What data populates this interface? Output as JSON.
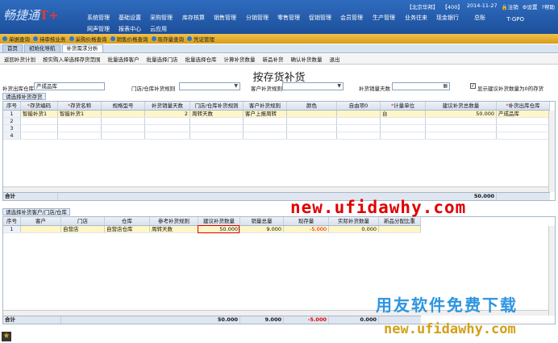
{
  "app": {
    "logo_text": "畅捷通",
    "logo_mark": "T+"
  },
  "menu_row1": [
    "系统管理",
    "基础设置",
    "采购管理",
    "库存核算",
    "销售管理",
    "分销管理",
    "零售管理",
    "促销管理",
    "会员管理",
    "生产管理",
    "业务往来",
    "现金银行",
    "总账"
  ],
  "menu_row2": [
    "网声管理",
    "报表中心",
    "云应用"
  ],
  "info": {
    "company": "【北京华邦】",
    "account": "【400】",
    "date": "2014-11-27",
    "logout": "注销",
    "settings": "设置",
    "help": "帮助",
    "version": "T-GPO"
  },
  "quickbar": [
    "单据查询",
    "待审核业务",
    "采购价格查询",
    "销售价格查询",
    "现存量查询",
    "凭证管理"
  ],
  "tabs": [
    "首页",
    "初始化导航",
    "补货需求分析"
  ],
  "toolbar": [
    "返回补货计划",
    "按实购入单选择存货范围",
    "批量选择客户",
    "批量选择门店",
    "批量选择仓库",
    "计算补货数量",
    "新品补货",
    "确认补货数量",
    "退出"
  ],
  "page_title": "按存货补货",
  "filters": {
    "warehouse_label": "补货出库仓库",
    "warehouse_value": "产成品库",
    "store_rule_label": "门店/仓库补货规则",
    "customer_rule_label": "客户补货规则",
    "sales_days_label": "补货销量天数",
    "checkbox_label": "显示建议补货数量为0的存货",
    "checked": true
  },
  "upper_section": "请选择补货存货",
  "upper_grid": {
    "columns": [
      "序号",
      "存货编码",
      "存货名称",
      "规格型号",
      "补货销量天数",
      "门店/仓库补货规则",
      "客户补货规则",
      "颜色",
      "自由项0",
      "计量单位",
      "建议补货总数量",
      "补货出库仓库"
    ],
    "required": [
      false,
      true,
      true,
      false,
      false,
      false,
      false,
      false,
      false,
      true,
      false,
      true
    ],
    "rows": [
      [
        "1",
        "智能补货1",
        "智能补货1",
        "",
        "2",
        "周转天数",
        "客户上报周转",
        "",
        "",
        "台",
        "50.000",
        "产成品库"
      ],
      [
        "2",
        "",
        "",
        "",
        "",
        "",
        "",
        "",
        "",
        "",
        "",
        ""
      ],
      [
        "3",
        "",
        "",
        "",
        "",
        "",
        "",
        "",
        "",
        "",
        "",
        ""
      ],
      [
        "4",
        "",
        "",
        "",
        "",
        "",
        "",
        "",
        "",
        "",
        "",
        ""
      ]
    ],
    "total_label": "合计",
    "total_value": "50.000"
  },
  "lower_section": "请选择补货客户/门店/仓库",
  "lower_grid": {
    "columns": [
      "序号",
      "客户",
      "门店",
      "仓库",
      "参考补货规则",
      "建议补货数量",
      "销量总量",
      "现存量",
      "实际补货数量",
      "新品分配比重"
    ],
    "rows": [
      [
        "1",
        "",
        "自营店",
        "自营店仓库",
        "周转天数",
        "50.000",
        "9.000",
        "-5.000",
        "0.000",
        ""
      ]
    ],
    "total_label": "合计",
    "totals": [
      "",
      "",
      "",
      "",
      "",
      "50.000",
      "9.000",
      "-5.000",
      "0.000",
      ""
    ]
  },
  "watermarks": {
    "url_red": "new.ufidawhy.com",
    "slogan": "用友软件免费下载",
    "url_gold": "new.ufidawhy.com"
  },
  "colors": {
    "header_blue": "#1c4f9a",
    "quickbar_gold": "#d69c1a",
    "negative": "#e00000",
    "selected_row": "#fff6c7"
  }
}
